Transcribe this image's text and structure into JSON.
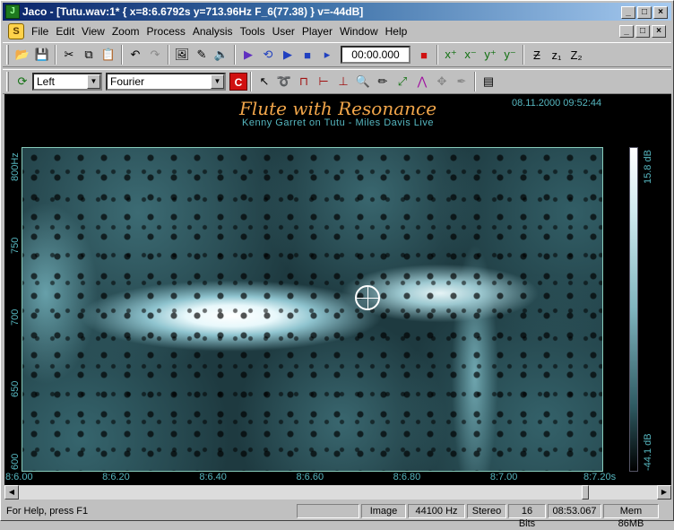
{
  "window": {
    "title": "Jaco - [Tutu.wav:1*  {  x=8:6.6792s  y=713.96Hz  F_6(77.38)  } v=-44dB]",
    "controls": [
      "_",
      "□",
      "×"
    ]
  },
  "menubar": {
    "items": [
      "File",
      "Edit",
      "View",
      "Zoom",
      "Process",
      "Analysis",
      "Tools",
      "User",
      "Player",
      "Window",
      "Help"
    ],
    "mdi_controls": [
      "_",
      "□",
      "×"
    ]
  },
  "toolbar1": {
    "time_value": "00:00.000"
  },
  "toolbar2": {
    "channel": "Left",
    "transform": "Fourier",
    "c_button": "C"
  },
  "plot": {
    "title": "Flute with Resonance",
    "subtitle": "Kenny Garret on Tutu - Miles Davis Live",
    "date": "08.11.2000 09:52:44",
    "colorbar_max": "15.8 dB",
    "colorbar_min": "-44.1 dB"
  },
  "chart_data": {
    "type": "heatmap",
    "title": "Flute with Resonance",
    "subtitle": "Kenny Garret on Tutu - Miles Davis Live",
    "xlabel": "",
    "ylabel": "",
    "x_ticks": [
      "8:6.00",
      "8:6.20",
      "8:6.40",
      "8:6.60",
      "8:6.80",
      "8:7.00",
      "8:7.20s"
    ],
    "y_ticks": [
      "600",
      "650",
      "700",
      "750",
      "800Hz"
    ],
    "ylim": [
      590,
      815
    ],
    "colorbar_range_db": [
      -44.1,
      15.8
    ],
    "cursor": {
      "x": "8:6.6792s",
      "y": "713.96Hz"
    }
  },
  "status": {
    "help": "For Help, press F1",
    "panels": [
      "",
      "Image",
      "44100 Hz",
      "Stereo",
      "16 Bits",
      "08:53.067",
      "Mem 86MB"
    ]
  }
}
